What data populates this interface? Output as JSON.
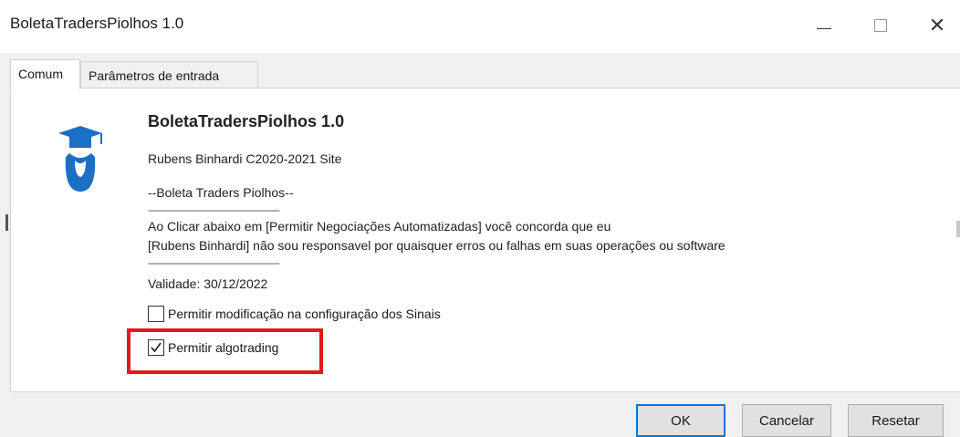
{
  "window": {
    "title": "BoletaTradersPiolhos 1.0",
    "minimize_glyph": "—",
    "close_glyph": "✕"
  },
  "tabs": [
    {
      "label": "Comum",
      "active": true
    },
    {
      "label": "Parâmetros de entrada",
      "active": false
    }
  ],
  "about": {
    "app_name": "BoletaTradersPiolhos 1.0",
    "author": "Rubens Binhardi C2020-2021 Site",
    "subtitle": "--Boleta Traders Piolhos--",
    "separator1": "------------------------------------------------",
    "disclaimer_line1": "Ao Clicar abaixo em [Permitir Negociações Automatizadas] você concorda que eu",
    "disclaimer_line2": "[Rubens Binhardi] não sou responsavel por quaisquer erros ou falhas em suas operações ou software",
    "separator2": "------------------------------------------------",
    "validity": "Validade: 30/12/2022"
  },
  "options": [
    {
      "label": "Permitir modificação na configuração dos Sinais",
      "checked": false
    },
    {
      "label": "Permitir algotrading",
      "checked": true
    }
  ],
  "highlight_color": "#e8151c",
  "logo_color": "#1b6fc4",
  "buttons": {
    "ok": "OK",
    "cancel": "Cancelar",
    "reset": "Resetar"
  },
  "icons": {
    "logo": "graduate-icon",
    "checkmark": "check-icon"
  }
}
